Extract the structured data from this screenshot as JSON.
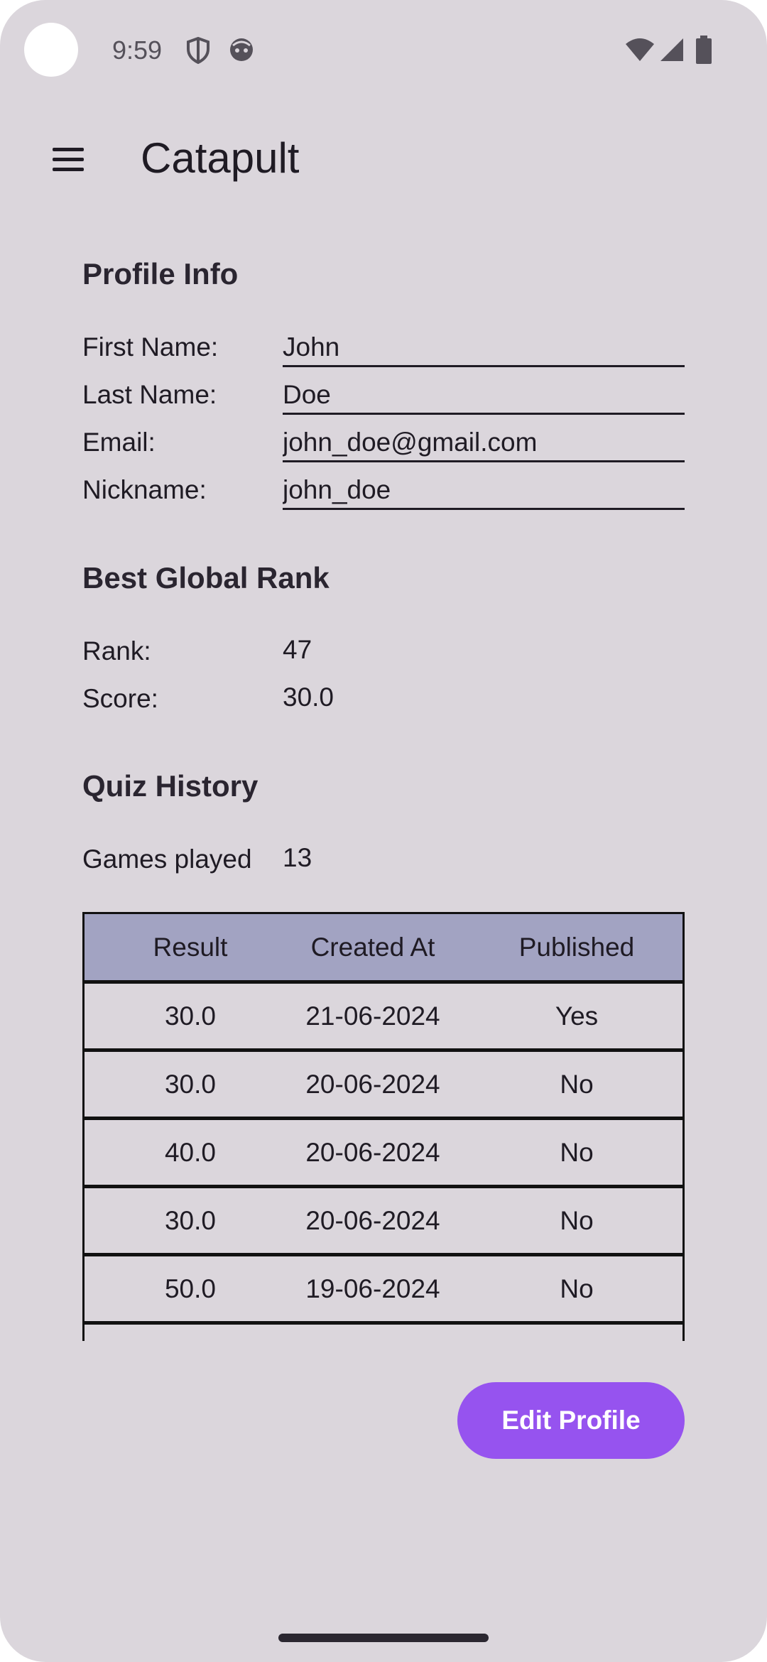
{
  "status_bar": {
    "time": "9:59"
  },
  "app_bar": {
    "title": "Catapult"
  },
  "profile_info": {
    "title": "Profile Info",
    "fields": [
      {
        "label": "First Name:",
        "value": "John"
      },
      {
        "label": "Last Name:",
        "value": "Doe"
      },
      {
        "label": "Email:",
        "value": "john_doe@gmail.com"
      },
      {
        "label": "Nickname:",
        "value": "john_doe"
      }
    ]
  },
  "best_rank": {
    "title": "Best Global Rank",
    "rank_label": "Rank:",
    "rank_value": "47",
    "score_label": "Score:",
    "score_value": "30.0"
  },
  "quiz_history": {
    "title": "Quiz History",
    "games_label": "Games played",
    "games_value": "13",
    "columns": [
      "Result",
      "Created At",
      "Published"
    ],
    "rows": [
      [
        "30.0",
        "21-06-2024",
        "Yes"
      ],
      [
        "30.0",
        "20-06-2024",
        "No"
      ],
      [
        "40.0",
        "20-06-2024",
        "No"
      ],
      [
        "30.0",
        "20-06-2024",
        "No"
      ],
      [
        "50.0",
        "19-06-2024",
        "No"
      ]
    ]
  },
  "edit_button": {
    "label": "Edit Profile"
  },
  "colors": {
    "accent": "#9653ef",
    "table_header": "#a2a3c2",
    "background": "#dbd6dc"
  }
}
